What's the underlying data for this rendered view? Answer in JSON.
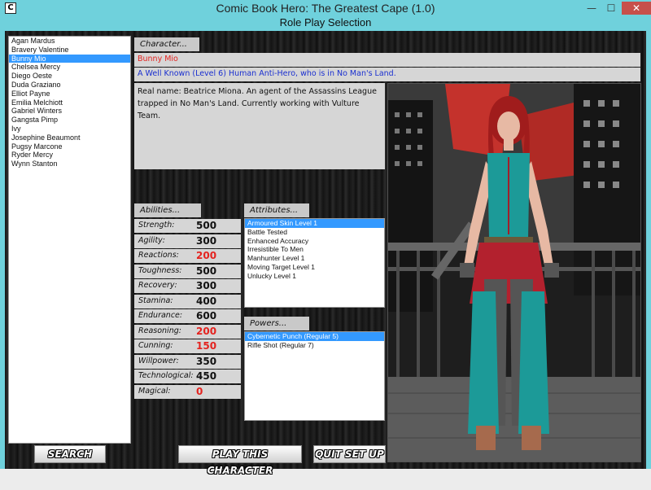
{
  "window": {
    "title": "Comic Book Hero: The Greatest Cape (1.0)",
    "min_glyph": "—",
    "max_glyph": "☐",
    "close_glyph": "✕",
    "app_icon": "C"
  },
  "dialog": {
    "title": "Role Play Selection"
  },
  "characters": {
    "items": [
      "Agan Mardus",
      "Bravery Valentine",
      "Bunny Mio",
      "Chelsea Mercy",
      "Diego Oeste",
      "Duda Graziano",
      "Elliot Payne",
      "Emilia Melchiott",
      "Gabriel Winters",
      "Gangsta Pimp",
      "Ivy",
      "Josephine Beaumont",
      "Pugsy Marcone",
      "Ryder Mercy",
      "Wynn Stanton"
    ],
    "selected": "Bunny Mio"
  },
  "character_panel": {
    "tab": "Character...",
    "name": "Bunny Mio",
    "summary": "A Well Known (Level 6) Human Anti-Hero, who is in No Man's Land.",
    "description": "Real name: Beatrice Miona. An agent of the Assassins League trapped in No Man's Land. Currently working with Vulture Team."
  },
  "abilities": {
    "tab": "Abilities...",
    "items": [
      {
        "label": "Strength:",
        "value": "500",
        "red": false
      },
      {
        "label": "Agility:",
        "value": "300",
        "red": false
      },
      {
        "label": "Reactions:",
        "value": "200",
        "red": true
      },
      {
        "label": "Toughness:",
        "value": "500",
        "red": false
      },
      {
        "label": "Recovery:",
        "value": "300",
        "red": false
      },
      {
        "label": "Stamina:",
        "value": "400",
        "red": false
      },
      {
        "label": "Endurance:",
        "value": "600",
        "red": false
      },
      {
        "label": "Reasoning:",
        "value": "200",
        "red": true
      },
      {
        "label": "Cunning:",
        "value": "150",
        "red": true
      },
      {
        "label": "Willpower:",
        "value": "350",
        "red": false
      },
      {
        "label": "Technological:",
        "value": "450",
        "red": false
      },
      {
        "label": "Magical:",
        "value": "0",
        "red": true
      }
    ]
  },
  "attributes": {
    "tab": "Attributes...",
    "items": [
      "Armoured Skin Level 1",
      "Battle Tested",
      "Enhanced Accuracy",
      "Irresistible To Men",
      "Manhunter Level 1",
      "Moving Target Level 1",
      "Unlucky Level 1"
    ],
    "selected": "Armoured Skin Level 1"
  },
  "powers": {
    "tab": "Powers...",
    "items": [
      "Cybernetic Punch (Regular 5)",
      "Rifle Shot (Regular 7)"
    ],
    "selected": "Cybernetic Punch (Regular 5)"
  },
  "buttons": {
    "search": "SEARCH",
    "play": "PLAY THIS CHARACTER",
    "quit": "QUIT SET UP"
  },
  "colors": {
    "accent": "#6fd1dc",
    "selection": "#3399ff",
    "name_red": "#e4231f",
    "summary_blue": "#1a2fd0",
    "low_stat_red": "#e4231f"
  }
}
